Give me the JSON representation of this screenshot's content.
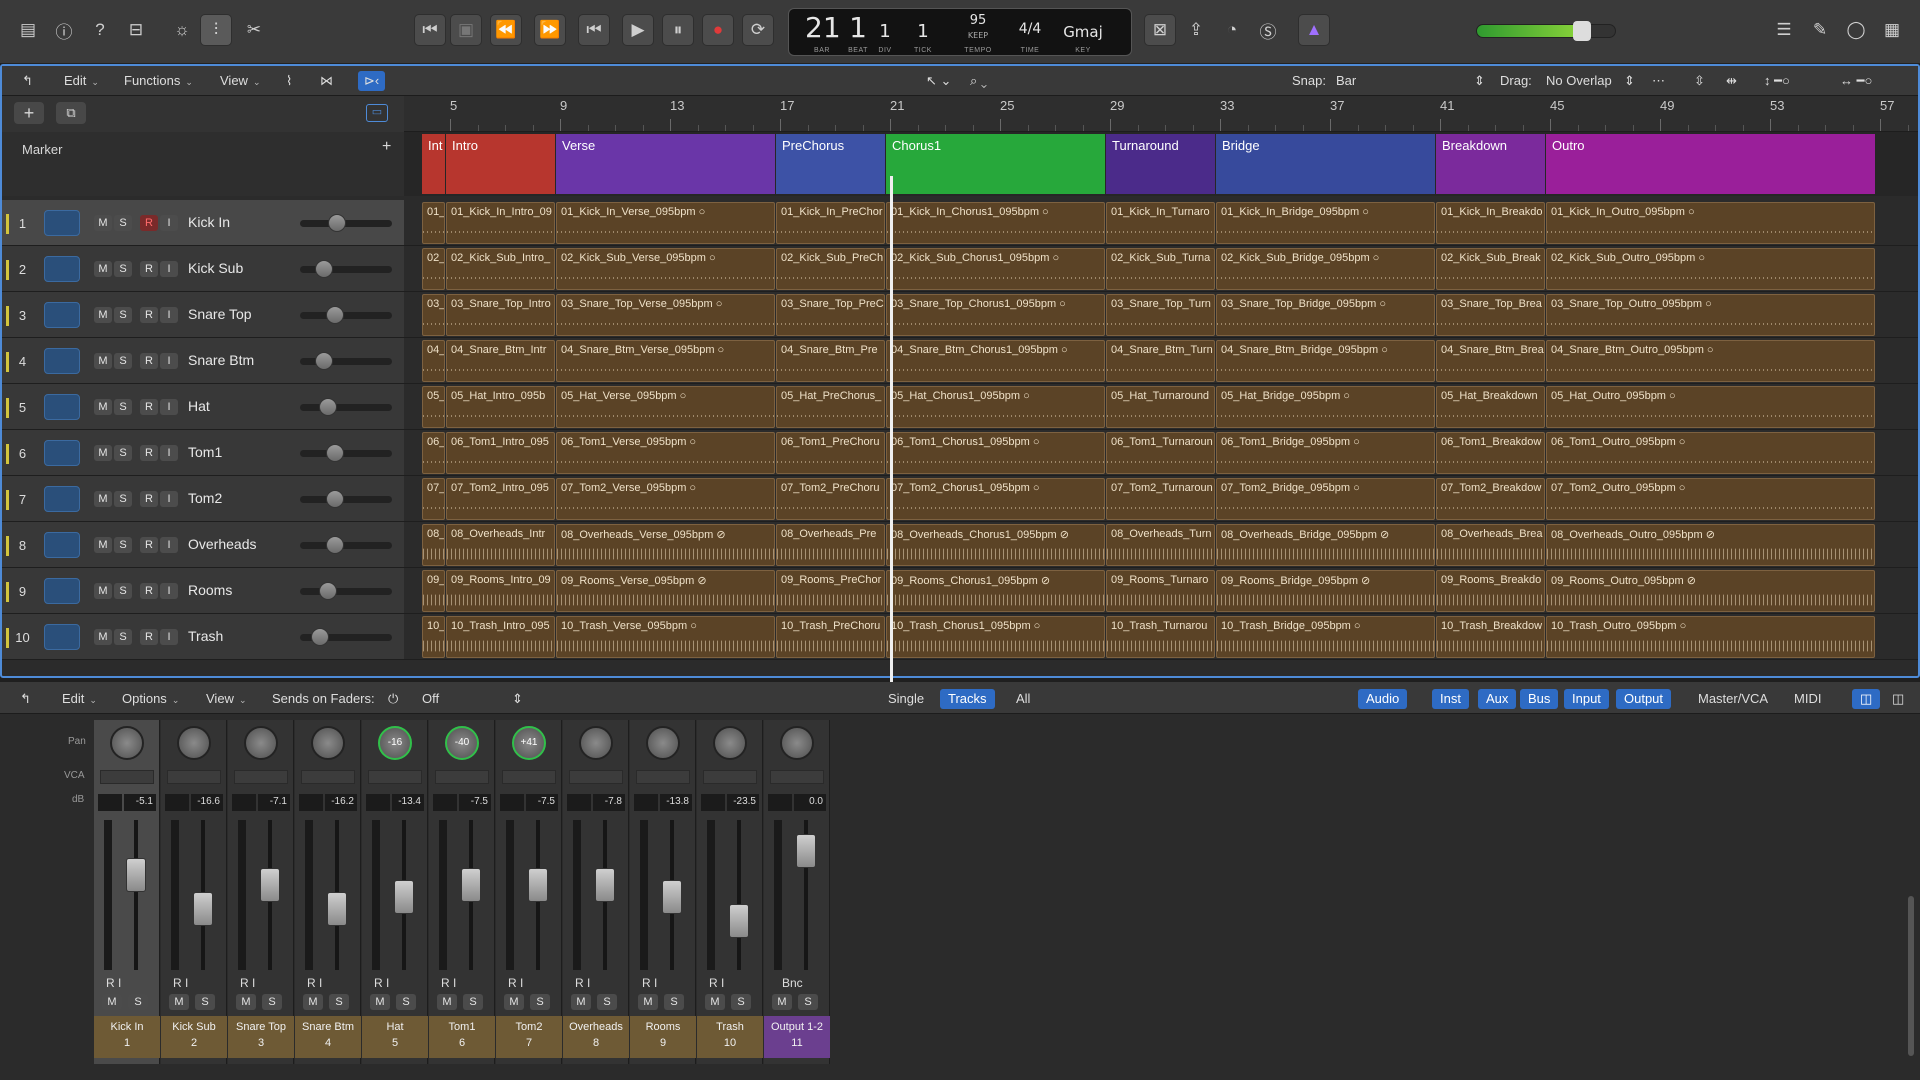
{
  "lcd": {
    "bar": "21",
    "beat": "1",
    "div": "1",
    "tick": "1",
    "tempo": "95",
    "tempo_sub": "KEEP",
    "sig": "4/4",
    "key": "Gmaj",
    "bar_l": "BAR",
    "beat_l": "BEAT",
    "div_l": "DIV",
    "tick_l": "TICK",
    "tempo_l": "TEMPO",
    "time_l": "TIME",
    "key_l": "KEY"
  },
  "toolbar": {
    "edit": "Edit",
    "functions": "Functions",
    "view": "View",
    "snap_label": "Snap:",
    "snap_value": "Bar",
    "drag_label": "Drag:",
    "drag_value": "No Overlap"
  },
  "marker_label": "Marker",
  "ruler": [
    "5",
    "9",
    "13",
    "17",
    "21",
    "25",
    "29",
    "33",
    "37",
    "41",
    "45",
    "49",
    "53",
    "57"
  ],
  "markers": [
    {
      "name": "Int",
      "color": "#b7362e"
    },
    {
      "name": "Intro",
      "color": "#b7362e"
    },
    {
      "name": "Verse",
      "color": "#6a36a8"
    },
    {
      "name": "PreChorus",
      "color": "#3d52a6"
    },
    {
      "name": "Chorus1",
      "color": "#27a83b"
    },
    {
      "name": "Turnaround",
      "color": "#4b2b8a"
    },
    {
      "name": "Bridge",
      "color": "#374a9c"
    },
    {
      "name": "Breakdown",
      "color": "#7b2a9c"
    },
    {
      "name": "Outro",
      "color": "#9a1f9a"
    }
  ],
  "tracks": [
    {
      "num": "1",
      "name": "Kick In",
      "knob": 0.38,
      "regions": [
        "01_",
        "01_Kick_In_Intro_09",
        "01_Kick_In_Verse_095bpm  ○",
        "01_Kick_In_PreChor",
        "01_Kick_In_Chorus1_095bpm  ○",
        "01_Kick_In_Turnaro",
        "01_Kick_In_Bridge_095bpm  ○",
        "01_Kick_In_Breakdo",
        "01_Kick_In_Outro_095bpm  ○"
      ]
    },
    {
      "num": "2",
      "name": "Kick Sub",
      "knob": 0.2,
      "regions": [
        "02_",
        "02_Kick_Sub_Intro_",
        "02_Kick_Sub_Verse_095bpm  ○",
        "02_Kick_Sub_PreCh",
        "02_Kick_Sub_Chorus1_095bpm  ○",
        "02_Kick_Sub_Turna",
        "02_Kick_Sub_Bridge_095bpm  ○",
        "02_Kick_Sub_Break",
        "02_Kick_Sub_Outro_095bpm  ○"
      ]
    },
    {
      "num": "3",
      "name": "Snare Top",
      "knob": 0.35,
      "regions": [
        "03_",
        "03_Snare_Top_Intro",
        "03_Snare_Top_Verse_095bpm  ○",
        "03_Snare_Top_PreC",
        "03_Snare_Top_Chorus1_095bpm  ○",
        "03_Snare_Top_Turn",
        "03_Snare_Top_Bridge_095bpm  ○",
        "03_Snare_Top_Brea",
        "03_Snare_Top_Outro_095bpm  ○"
      ]
    },
    {
      "num": "4",
      "name": "Snare Btm",
      "knob": 0.2,
      "regions": [
        "04_",
        "04_Snare_Btm_Intr",
        "04_Snare_Btm_Verse_095bpm  ○",
        "04_Snare_Btm_Pre",
        "04_Snare_Btm_Chorus1_095bpm  ○",
        "04_Snare_Btm_Turn",
        "04_Snare_Btm_Bridge_095bpm  ○",
        "04_Snare_Btm_Brea",
        "04_Snare_Btm_Outro_095bpm  ○"
      ]
    },
    {
      "num": "5",
      "name": "Hat",
      "knob": 0.25,
      "regions": [
        "05_",
        "05_Hat_Intro_095b",
        "05_Hat_Verse_095bpm  ○",
        "05_Hat_PreChorus_",
        "05_Hat_Chorus1_095bpm  ○",
        "05_Hat_Turnaround",
        "05_Hat_Bridge_095bpm  ○",
        "05_Hat_Breakdown",
        "05_Hat_Outro_095bpm  ○"
      ]
    },
    {
      "num": "6",
      "name": "Tom1",
      "knob": 0.35,
      "regions": [
        "06_",
        "06_Tom1_Intro_095",
        "06_Tom1_Verse_095bpm  ○",
        "06_Tom1_PreChoru",
        "06_Tom1_Chorus1_095bpm  ○",
        "06_Tom1_Turnaroun",
        "06_Tom1_Bridge_095bpm  ○",
        "06_Tom1_Breakdow",
        "06_Tom1_Outro_095bpm  ○"
      ]
    },
    {
      "num": "7",
      "name": "Tom2",
      "knob": 0.35,
      "regions": [
        "07_",
        "07_Tom2_Intro_095",
        "07_Tom2_Verse_095bpm  ○",
        "07_Tom2_PreChoru",
        "07_Tom2_Chorus1_095bpm  ○",
        "07_Tom2_Turnaroun",
        "07_Tom2_Bridge_095bpm  ○",
        "07_Tom2_Breakdow",
        "07_Tom2_Outro_095bpm  ○"
      ]
    },
    {
      "num": "8",
      "name": "Overheads",
      "knob": 0.35,
      "regions": [
        "08_",
        "08_Overheads_Intr",
        "08_Overheads_Verse_095bpm  ⊘",
        "08_Overheads_Pre",
        "08_Overheads_Chorus1_095bpm  ⊘",
        "08_Overheads_Turn",
        "08_Overheads_Bridge_095bpm  ⊘",
        "08_Overheads_Brea",
        "08_Overheads_Outro_095bpm  ⊘"
      ]
    },
    {
      "num": "9",
      "name": "Rooms",
      "knob": 0.25,
      "regions": [
        "09_",
        "09_Rooms_Intro_09",
        "09_Rooms_Verse_095bpm  ⊘",
        "09_Rooms_PreChor",
        "09_Rooms_Chorus1_095bpm  ⊘",
        "09_Rooms_Turnaro",
        "09_Rooms_Bridge_095bpm  ⊘",
        "09_Rooms_Breakdo",
        "09_Rooms_Outro_095bpm  ⊘"
      ]
    },
    {
      "num": "10",
      "name": "Trash",
      "knob": 0.15,
      "regions": [
        "10_",
        "10_Trash_Intro_095",
        "10_Trash_Verse_095bpm  ○",
        "10_Trash_PreChoru",
        "10_Trash_Chorus1_095bpm  ○",
        "10_Trash_Turnarou",
        "10_Trash_Bridge_095bpm  ○",
        "10_Trash_Breakdow",
        "10_Trash_Outro_095bpm  ○"
      ]
    }
  ],
  "mixer_toolbar": {
    "edit": "Edit",
    "options": "Options",
    "view": "View",
    "sends": "Sends on Faders:",
    "sends_value": "Off",
    "single": "Single",
    "tracks": "Tracks",
    "all": "All",
    "audio": "Audio",
    "inst": "Inst",
    "aux": "Aux",
    "bus": "Bus",
    "input": "Input",
    "output": "Output",
    "master": "Master/VCA",
    "midi": "MIDI"
  },
  "mixer_labels": {
    "pan": "Pan",
    "vca": "VCA",
    "db": "dB"
  },
  "strips": [
    {
      "name": "Kick In",
      "num": "1",
      "pan": "",
      "db": "-5.1",
      "fader": 0.32,
      "ri": "R I"
    },
    {
      "name": "Kick Sub",
      "num": "2",
      "pan": "",
      "db": "-16.6",
      "fader": 0.6,
      "ri": "R I"
    },
    {
      "name": "Snare Top",
      "num": "3",
      "pan": "",
      "db": "-7.1",
      "fader": 0.4,
      "ri": "R I"
    },
    {
      "name": "Snare Btm",
      "num": "4",
      "pan": "",
      "db": "-16.2",
      "fader": 0.6,
      "ri": "R I"
    },
    {
      "name": "Hat",
      "num": "5",
      "pan": "-16",
      "db": "-13.4",
      "fader": 0.5,
      "ri": "R I"
    },
    {
      "name": "Tom1",
      "num": "6",
      "pan": "-40",
      "db": "-7.5",
      "fader": 0.4,
      "ri": "R I"
    },
    {
      "name": "Tom2",
      "num": "7",
      "pan": "+41",
      "db": "-7.5",
      "fader": 0.4,
      "ri": "R I"
    },
    {
      "name": "Overheads",
      "num": "8",
      "pan": "",
      "db": "-7.8",
      "fader": 0.4,
      "ri": "R I"
    },
    {
      "name": "Rooms",
      "num": "9",
      "pan": "",
      "db": "-13.8",
      "fader": 0.5,
      "ri": "R I"
    },
    {
      "name": "Trash",
      "num": "10",
      "pan": "",
      "db": "-23.5",
      "fader": 0.7,
      "ri": "R I"
    },
    {
      "name": "Output 1-2",
      "num": "11",
      "pan": "",
      "db": "0.0",
      "fader": 0.12,
      "ri": "Bnc"
    }
  ],
  "btn": {
    "m": "M",
    "s": "S",
    "r": "R",
    "i": "I"
  }
}
